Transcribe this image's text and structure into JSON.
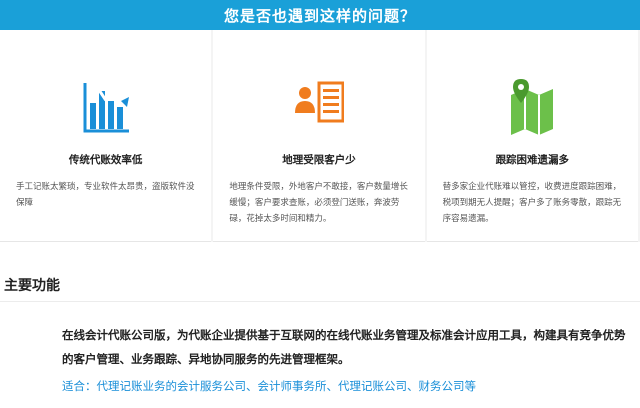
{
  "banner": {
    "title": "您是否也遇到这样的问题？"
  },
  "cards": [
    {
      "icon": "bar-chart-decline-icon",
      "title": "传统代账效率低",
      "desc": "手工记账太繁琐，专业软件太昂贵，盗版软件没保障"
    },
    {
      "icon": "user-list-icon",
      "title": "地理受限客户少",
      "desc": "地理条件受限，外地客户不敢接，客户数量增长缓慢；客户要求查账，必须登门送账，奔波劳碌，花掉太多时间和精力。"
    },
    {
      "icon": "map-pin-icon",
      "title": "跟踪困难遗漏多",
      "desc": "替多家企业代账难以管控，收费进度跟踪困难，税项到期无人提醒；客户多了账务零散，跟踪无序容易遗漏。"
    }
  ],
  "section": {
    "title": "主要功能"
  },
  "main": {
    "description": "在线会计代账公司版，为代账企业提供基于互联网的在线代账业务管理及标准会计应用工具，构建具有竞争优势的客户管理、业务跟踪、异地协同服务的先进管理框架。",
    "suitable": "适合：代理记账业务的会计服务公司、会计师事务所、代理记账公司、财务公司等"
  },
  "colors": {
    "banner": "#1aa0d8",
    "icon_blue": "#1a8fd8",
    "icon_orange": "#f07c1e",
    "icon_green": "#6cc04a",
    "link_blue": "#1a8fd8"
  }
}
